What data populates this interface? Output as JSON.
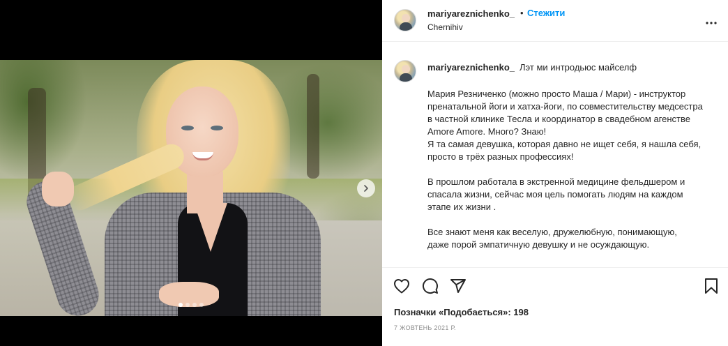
{
  "post": {
    "author": {
      "username": "mariyareznichenko_",
      "location": "Chernihiv"
    },
    "follow_separator": "•",
    "follow_label": "Стежити",
    "media": {
      "slide_count": 4,
      "active_slide": 1
    },
    "caption": {
      "username": "mariyareznichenko_",
      "title": "Лэт ми интродьюс майселф",
      "paragraphs": [
        {
          "lines": [
            "Мария Резниченко (можно просто Маша / Мари) - инструктор",
            "пренатальной йоги и хатха-йоги, по совместительству медсестра",
            "в частной клинике Тесла и координатор в свадебном агенстве",
            "Amore Amore. Много? Знаю!",
            "Я та самая девушка, которая давно не ищет себя, я нашла себя,",
            "просто в трёх разных профессиях!"
          ]
        },
        {
          "lines": [
            "В прошлом работала в экстренной медицине фельдшером и",
            "спасала жизни, сейчас моя цель помогать людям на каждом",
            "этапе их жизни ."
          ]
        },
        {
          "lines": [
            "Все знают меня как веселую, дружелюбную, понимающую,",
            "даже порой эмпатичную девушку и не осуждающую."
          ]
        }
      ]
    },
    "likes_text": "Позначки «Подобається»: 198",
    "date": "7 жовтень 2021 р."
  },
  "icons": {
    "more": "more-horizontal-icon",
    "next": "chevron-right-icon",
    "like": "heart-icon",
    "comment": "comment-icon",
    "share": "paper-plane-icon",
    "save": "bookmark-icon"
  },
  "colors": {
    "accent": "#0095f6",
    "text": "#262626",
    "muted": "#8e8e8e"
  }
}
